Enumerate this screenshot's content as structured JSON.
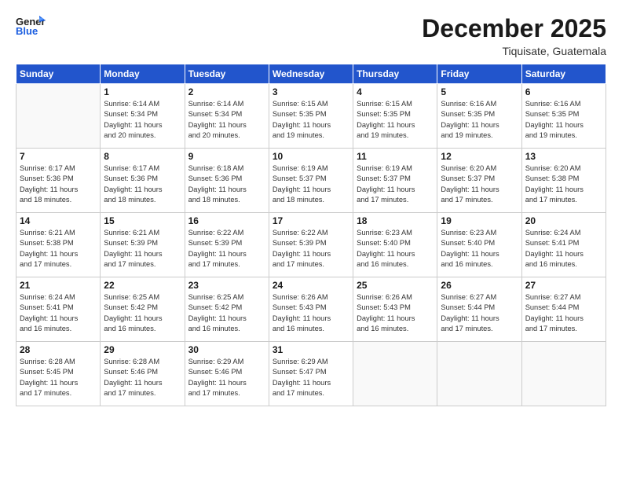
{
  "header": {
    "logo_general": "General",
    "logo_blue": "Blue",
    "month_title": "December 2025",
    "location": "Tiquisate, Guatemala"
  },
  "weekdays": [
    "Sunday",
    "Monday",
    "Tuesday",
    "Wednesday",
    "Thursday",
    "Friday",
    "Saturday"
  ],
  "weeks": [
    [
      {
        "day": "",
        "info": ""
      },
      {
        "day": "1",
        "info": "Sunrise: 6:14 AM\nSunset: 5:34 PM\nDaylight: 11 hours\nand 20 minutes."
      },
      {
        "day": "2",
        "info": "Sunrise: 6:14 AM\nSunset: 5:34 PM\nDaylight: 11 hours\nand 20 minutes."
      },
      {
        "day": "3",
        "info": "Sunrise: 6:15 AM\nSunset: 5:35 PM\nDaylight: 11 hours\nand 19 minutes."
      },
      {
        "day": "4",
        "info": "Sunrise: 6:15 AM\nSunset: 5:35 PM\nDaylight: 11 hours\nand 19 minutes."
      },
      {
        "day": "5",
        "info": "Sunrise: 6:16 AM\nSunset: 5:35 PM\nDaylight: 11 hours\nand 19 minutes."
      },
      {
        "day": "6",
        "info": "Sunrise: 6:16 AM\nSunset: 5:35 PM\nDaylight: 11 hours\nand 19 minutes."
      }
    ],
    [
      {
        "day": "7",
        "info": "Sunrise: 6:17 AM\nSunset: 5:36 PM\nDaylight: 11 hours\nand 18 minutes."
      },
      {
        "day": "8",
        "info": "Sunrise: 6:17 AM\nSunset: 5:36 PM\nDaylight: 11 hours\nand 18 minutes."
      },
      {
        "day": "9",
        "info": "Sunrise: 6:18 AM\nSunset: 5:36 PM\nDaylight: 11 hours\nand 18 minutes."
      },
      {
        "day": "10",
        "info": "Sunrise: 6:19 AM\nSunset: 5:37 PM\nDaylight: 11 hours\nand 18 minutes."
      },
      {
        "day": "11",
        "info": "Sunrise: 6:19 AM\nSunset: 5:37 PM\nDaylight: 11 hours\nand 17 minutes."
      },
      {
        "day": "12",
        "info": "Sunrise: 6:20 AM\nSunset: 5:37 PM\nDaylight: 11 hours\nand 17 minutes."
      },
      {
        "day": "13",
        "info": "Sunrise: 6:20 AM\nSunset: 5:38 PM\nDaylight: 11 hours\nand 17 minutes."
      }
    ],
    [
      {
        "day": "14",
        "info": "Sunrise: 6:21 AM\nSunset: 5:38 PM\nDaylight: 11 hours\nand 17 minutes."
      },
      {
        "day": "15",
        "info": "Sunrise: 6:21 AM\nSunset: 5:39 PM\nDaylight: 11 hours\nand 17 minutes."
      },
      {
        "day": "16",
        "info": "Sunrise: 6:22 AM\nSunset: 5:39 PM\nDaylight: 11 hours\nand 17 minutes."
      },
      {
        "day": "17",
        "info": "Sunrise: 6:22 AM\nSunset: 5:39 PM\nDaylight: 11 hours\nand 17 minutes."
      },
      {
        "day": "18",
        "info": "Sunrise: 6:23 AM\nSunset: 5:40 PM\nDaylight: 11 hours\nand 16 minutes."
      },
      {
        "day": "19",
        "info": "Sunrise: 6:23 AM\nSunset: 5:40 PM\nDaylight: 11 hours\nand 16 minutes."
      },
      {
        "day": "20",
        "info": "Sunrise: 6:24 AM\nSunset: 5:41 PM\nDaylight: 11 hours\nand 16 minutes."
      }
    ],
    [
      {
        "day": "21",
        "info": "Sunrise: 6:24 AM\nSunset: 5:41 PM\nDaylight: 11 hours\nand 16 minutes."
      },
      {
        "day": "22",
        "info": "Sunrise: 6:25 AM\nSunset: 5:42 PM\nDaylight: 11 hours\nand 16 minutes."
      },
      {
        "day": "23",
        "info": "Sunrise: 6:25 AM\nSunset: 5:42 PM\nDaylight: 11 hours\nand 16 minutes."
      },
      {
        "day": "24",
        "info": "Sunrise: 6:26 AM\nSunset: 5:43 PM\nDaylight: 11 hours\nand 16 minutes."
      },
      {
        "day": "25",
        "info": "Sunrise: 6:26 AM\nSunset: 5:43 PM\nDaylight: 11 hours\nand 16 minutes."
      },
      {
        "day": "26",
        "info": "Sunrise: 6:27 AM\nSunset: 5:44 PM\nDaylight: 11 hours\nand 17 minutes."
      },
      {
        "day": "27",
        "info": "Sunrise: 6:27 AM\nSunset: 5:44 PM\nDaylight: 11 hours\nand 17 minutes."
      }
    ],
    [
      {
        "day": "28",
        "info": "Sunrise: 6:28 AM\nSunset: 5:45 PM\nDaylight: 11 hours\nand 17 minutes."
      },
      {
        "day": "29",
        "info": "Sunrise: 6:28 AM\nSunset: 5:46 PM\nDaylight: 11 hours\nand 17 minutes."
      },
      {
        "day": "30",
        "info": "Sunrise: 6:29 AM\nSunset: 5:46 PM\nDaylight: 11 hours\nand 17 minutes."
      },
      {
        "day": "31",
        "info": "Sunrise: 6:29 AM\nSunset: 5:47 PM\nDaylight: 11 hours\nand 17 minutes."
      },
      {
        "day": "",
        "info": ""
      },
      {
        "day": "",
        "info": ""
      },
      {
        "day": "",
        "info": ""
      }
    ]
  ]
}
